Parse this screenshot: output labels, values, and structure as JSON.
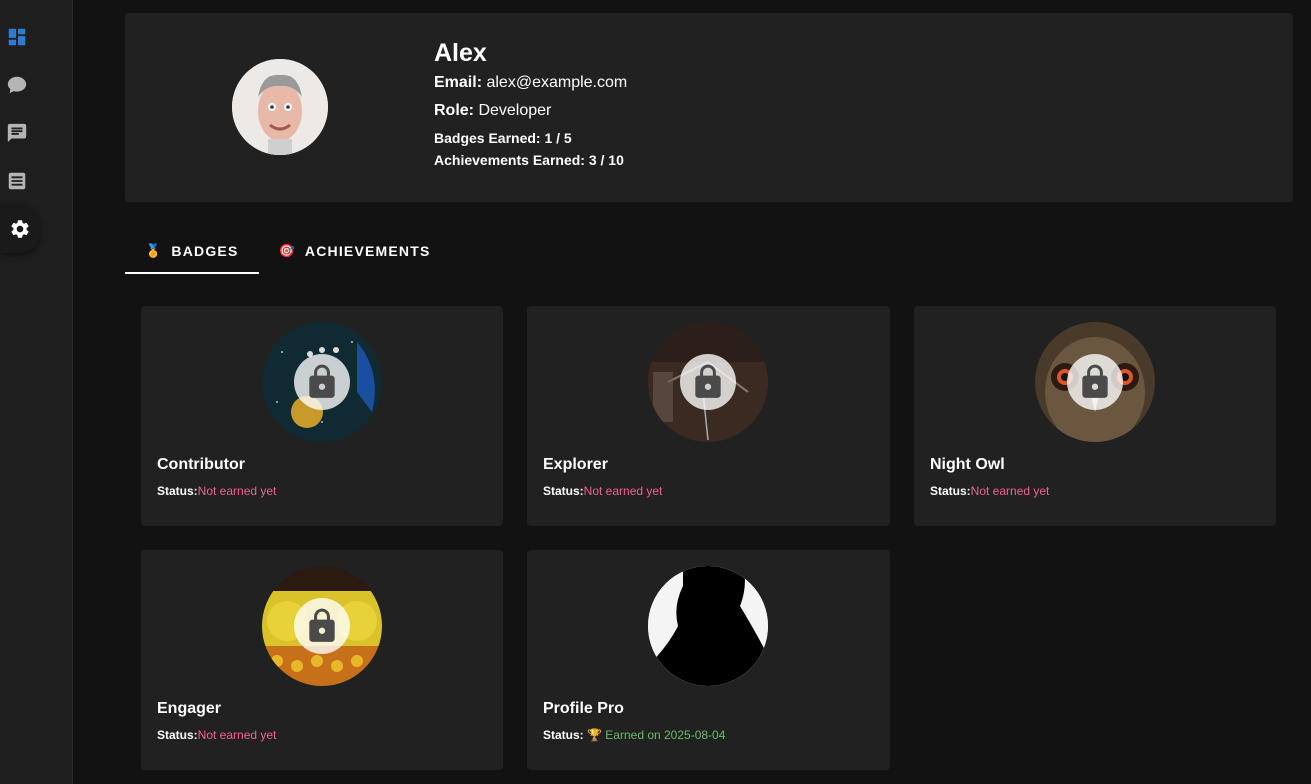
{
  "sidebar": {
    "items": [
      {
        "icon": "dashboard-icon"
      },
      {
        "icon": "chat-bubble-icon"
      },
      {
        "icon": "forum-icon"
      },
      {
        "icon": "article-icon"
      },
      {
        "icon": "gear-icon"
      }
    ],
    "accent": "#2d7bd4"
  },
  "profile": {
    "name": "Alex",
    "email_label": "Email:",
    "email": "alex@example.com",
    "role_label": "Role:",
    "role": "Developer",
    "badges_earned": "Badges Earned: 1 / 5",
    "achievements_earned": "Achievements Earned: 3 / 10"
  },
  "tabs": [
    {
      "emoji": "🏅",
      "label": "BADGES",
      "active": true
    },
    {
      "emoji": "🎯",
      "label": "ACHIEVEMENTS",
      "active": false
    }
  ],
  "badges": [
    {
      "name": "Contributor",
      "status_label": "Status:",
      "status": "Not earned yet",
      "earned": false
    },
    {
      "name": "Explorer",
      "status_label": "Status:",
      "status": "Not earned yet",
      "earned": false
    },
    {
      "name": "Night Owl",
      "status_label": "Status:",
      "status": "Not earned yet",
      "earned": false
    },
    {
      "name": "Engager",
      "status_label": "Status:",
      "status": "Not earned yet",
      "earned": false
    },
    {
      "name": "Profile Pro",
      "status_label": "Status:",
      "status": "🏆 Earned on 2025-08-04",
      "earned": true
    }
  ],
  "colors": {
    "background": "#121212",
    "card": "#212121",
    "not_earned": "#f06292",
    "earned": "#66bb6a"
  }
}
